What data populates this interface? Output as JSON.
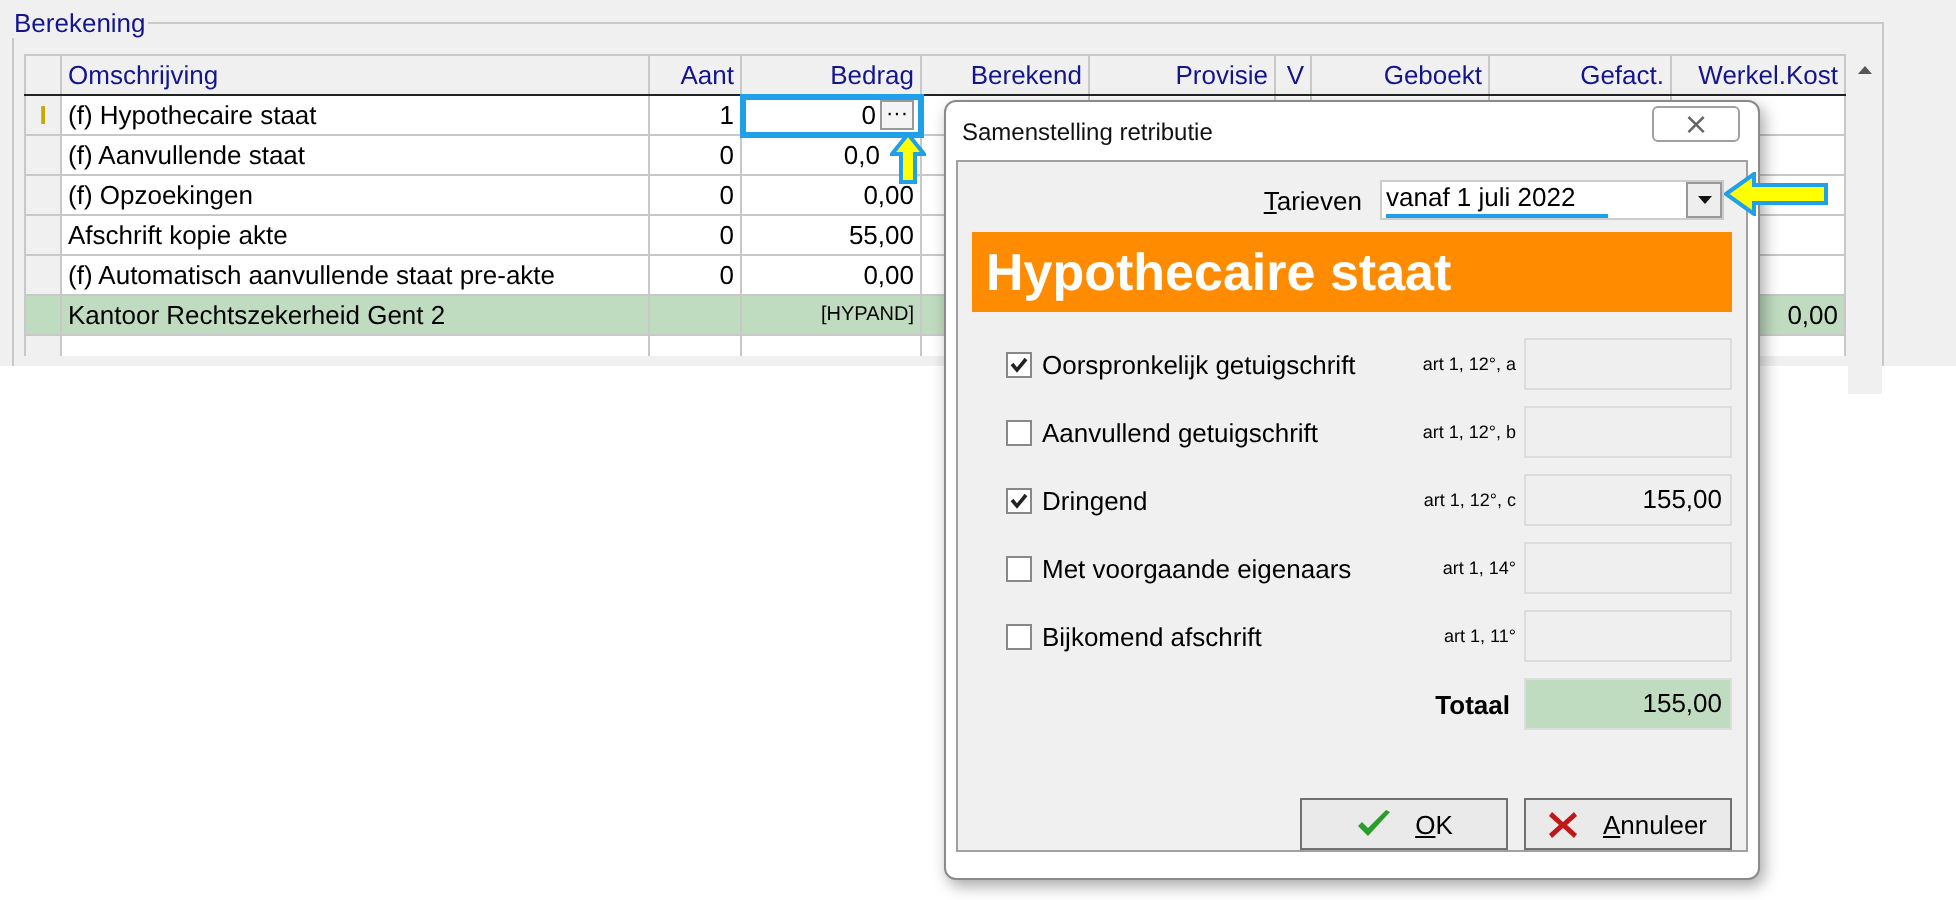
{
  "group": {
    "title": "Berekening"
  },
  "table": {
    "columns": [
      "Omschrijving",
      "Aant",
      "Bedrag",
      "Berekend",
      "Provisie",
      "V",
      "Geboekt",
      "Gefact.",
      "Werkel.Kost"
    ],
    "rows": [
      {
        "kind": "item",
        "marker": "I",
        "omschrijving": "(f) Hypothecaire staat",
        "aant": "1",
        "bedrag": "0",
        "editing": true,
        "button": "···"
      },
      {
        "kind": "item",
        "omschrijving": "(f) Aanvullende staat",
        "aant": "0",
        "bedrag": "0,0",
        "editing": false
      },
      {
        "kind": "item",
        "omschrijving": "(f) Opzoekingen",
        "aant": "0",
        "bedrag": "0,00",
        "editing": false
      },
      {
        "kind": "item",
        "omschrijving": "Afschrift kopie akte",
        "aant": "0",
        "bedrag": "55,00",
        "editing": false
      },
      {
        "kind": "item",
        "omschrijving": "(f) Automatisch aanvullende staat pre-akte",
        "aant": "0",
        "bedrag": "0,00",
        "editing": false
      },
      {
        "kind": "total",
        "omschrijving": "Kantoor Rechtszekerheid Gent 2",
        "bedrag": "[HYPAND]",
        "werkel_kost": "0,00",
        "editing": false
      }
    ]
  },
  "dialog": {
    "title": "Samenstelling retributie",
    "close": "⨯",
    "tarieven": {
      "label": "Tarieven",
      "value": "vanaf 1 juli 2022"
    },
    "banner": "Hypothecaire staat",
    "items": [
      {
        "label": "Oorspronkelijk getuigschrift",
        "article": "art 1, 12°, a",
        "checked": true
      },
      {
        "label": "Aanvullend getuigschrift",
        "article": "art 1, 12°, b",
        "checked": false
      },
      {
        "label": "Dringend",
        "article": "art 1, 12°, c",
        "checked": true,
        "amount": "155,00"
      },
      {
        "label": "Met voorgaande eigenaars",
        "article": "art 1, 14°",
        "checked": false
      },
      {
        "label": "Bijkomend afschrift",
        "article": "art 1, 11°",
        "checked": false
      }
    ],
    "total": {
      "label": "Totaal",
      "value": "155,00"
    },
    "buttons": [
      {
        "kind": "ok",
        "label": "OK"
      },
      {
        "kind": "cancel",
        "label": "Annuleer"
      }
    ]
  }
}
